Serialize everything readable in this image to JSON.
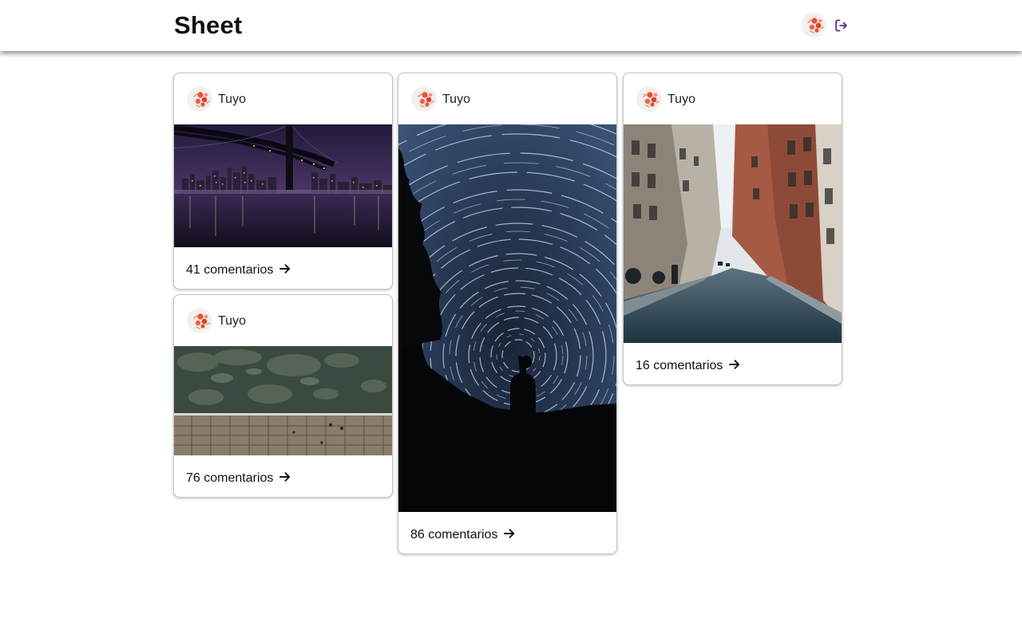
{
  "header": {
    "brand": "Sheet",
    "avatar_icon": "user-avatar-icon",
    "logout_icon": "logout-icon",
    "accent_color": "#5b2a86"
  },
  "posts": [
    {
      "user": "Tuyo",
      "image": "night-city-bridge-photo",
      "comments_label": "41 comentarios"
    },
    {
      "user": "Tuyo",
      "image": "star-trails-photo",
      "comments_label": "86 comentarios"
    },
    {
      "user": "Tuyo",
      "image": "city-street-photo",
      "comments_label": "16 comentarios"
    },
    {
      "user": "Tuyo",
      "image": "aerial-pier-photo",
      "comments_label": "76 comentarios"
    }
  ]
}
